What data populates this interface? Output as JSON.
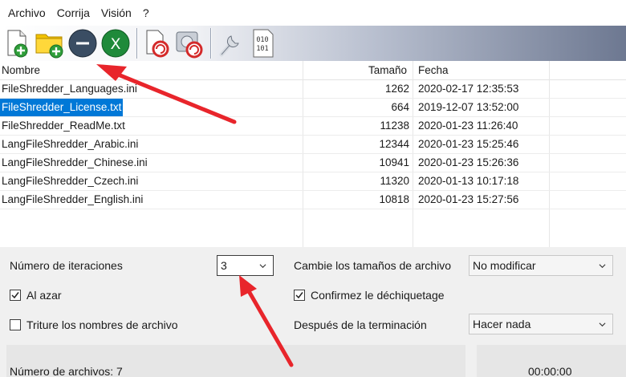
{
  "menu": {
    "items": [
      "Archivo",
      "Corrija",
      "Visión",
      "?"
    ]
  },
  "toolbar": {
    "buttons": [
      {
        "icon": "add-file-icon"
      },
      {
        "icon": "add-folder-icon"
      },
      {
        "icon": "remove-icon"
      },
      {
        "icon": "clear-list-icon"
      },
      {
        "icon": "shred-file-icon"
      },
      {
        "icon": "shred-disk-icon"
      },
      {
        "icon": "settings-wrench-icon"
      },
      {
        "icon": "binary-icon"
      }
    ]
  },
  "file_list": {
    "columns": {
      "name": "Nombre",
      "size": "Tamaño",
      "date": "Fecha"
    },
    "rows": [
      {
        "name": "FileShredder_Languages.ini",
        "size": "1262",
        "date": "2020-02-17 12:35:53"
      },
      {
        "name": "FileShredder_License.txt",
        "size": "664",
        "date": "2019-12-07 13:52:00",
        "selected": true
      },
      {
        "name": "FileShredder_ReadMe.txt",
        "size": "11238",
        "date": "2020-01-23 11:26:40"
      },
      {
        "name": "LangFileShredder_Arabic.ini",
        "size": "12344",
        "date": "2020-01-23 15:25:46"
      },
      {
        "name": "LangFileShredder_Chinese.ini",
        "size": "10941",
        "date": "2020-01-23 15:26:36"
      },
      {
        "name": "LangFileShredder_Czech.ini",
        "size": "11320",
        "date": "2020-01-13 10:17:18"
      },
      {
        "name": "LangFileShredder_English.ini",
        "size": "10818",
        "date": "2020-01-23 15:27:56"
      }
    ]
  },
  "options": {
    "iterations_label": "Número de iteraciones",
    "iterations_value": "3",
    "random_label": "Al azar",
    "random_checked": true,
    "shred_names_label": "Triture los nombres de archivo",
    "shred_names_checked": false,
    "change_sizes_label": "Cambie los tamaños de archivo",
    "change_sizes_value": "No modificar",
    "confirm_label": "Confirmez le déchiquetage",
    "confirm_checked": true,
    "after_label": "Después de la terminación",
    "after_value": "Hacer nada"
  },
  "status": {
    "file_count": "Número de archivos: 7",
    "timer": "00:00:00"
  },
  "colors": {
    "selection": "#0078d7",
    "annotation_arrow": "#e8252b"
  }
}
